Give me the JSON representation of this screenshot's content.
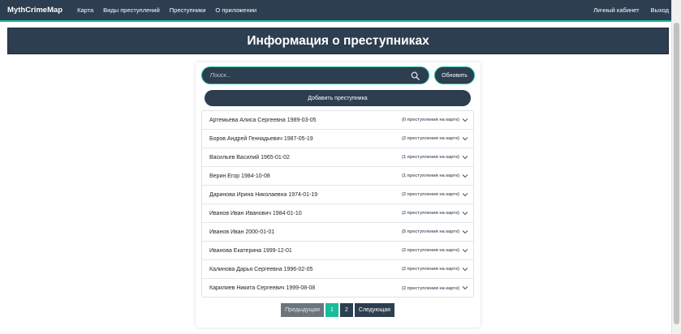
{
  "navbar": {
    "brand": "MythCrimeMap",
    "links": [
      "Карта",
      "Виды преступлений",
      "Преступники",
      "О приложении"
    ],
    "account": "Личный кабинет",
    "logout": "Выход"
  },
  "page_title": "Информация о преступниках",
  "search": {
    "placeholder": "Поиск..."
  },
  "refresh_label": "Обновить",
  "add_label": "Добавить преступника",
  "criminals": [
    {
      "name": "Артемьева Алиса Сергеевна 1989-03-05",
      "count": "(0 преступления на карте)"
    },
    {
      "name": "Боров Андрей Геннадьевич 1987-05-19",
      "count": "(2 преступления на карте)"
    },
    {
      "name": "Васильев Василий 1965-01-02",
      "count": "(1 преступления на карте)"
    },
    {
      "name": "Верин Егор 1984-10-08",
      "count": "(1 преступления на карте)"
    },
    {
      "name": "Даринова Ирина Николаевна 1974-01-19",
      "count": "(2 преступления на карте)"
    },
    {
      "name": "Иванов Иван Иванович 1984-01-10",
      "count": "(2 преступления на карте)"
    },
    {
      "name": "Иванов Иван 2000-01-01",
      "count": "(5 преступления на карте)"
    },
    {
      "name": "Иванова Екатерина 1999-12-01",
      "count": "(2 преступления на карте)"
    },
    {
      "name": "Калинова Дарья Сергеевна 1996-02-05",
      "count": "(2 преступления на карте)"
    },
    {
      "name": "Карилиев Никита Сергеевич 1999-08-08",
      "count": "(2 преступления на карте)"
    }
  ],
  "pagination": {
    "prev": "Предыдущая",
    "pages": [
      "1",
      "2"
    ],
    "next": "Следующая",
    "active": "1"
  },
  "colors": {
    "primary": "#2c3e50",
    "accent": "#1abc9c",
    "disabled": "#6c757d"
  }
}
